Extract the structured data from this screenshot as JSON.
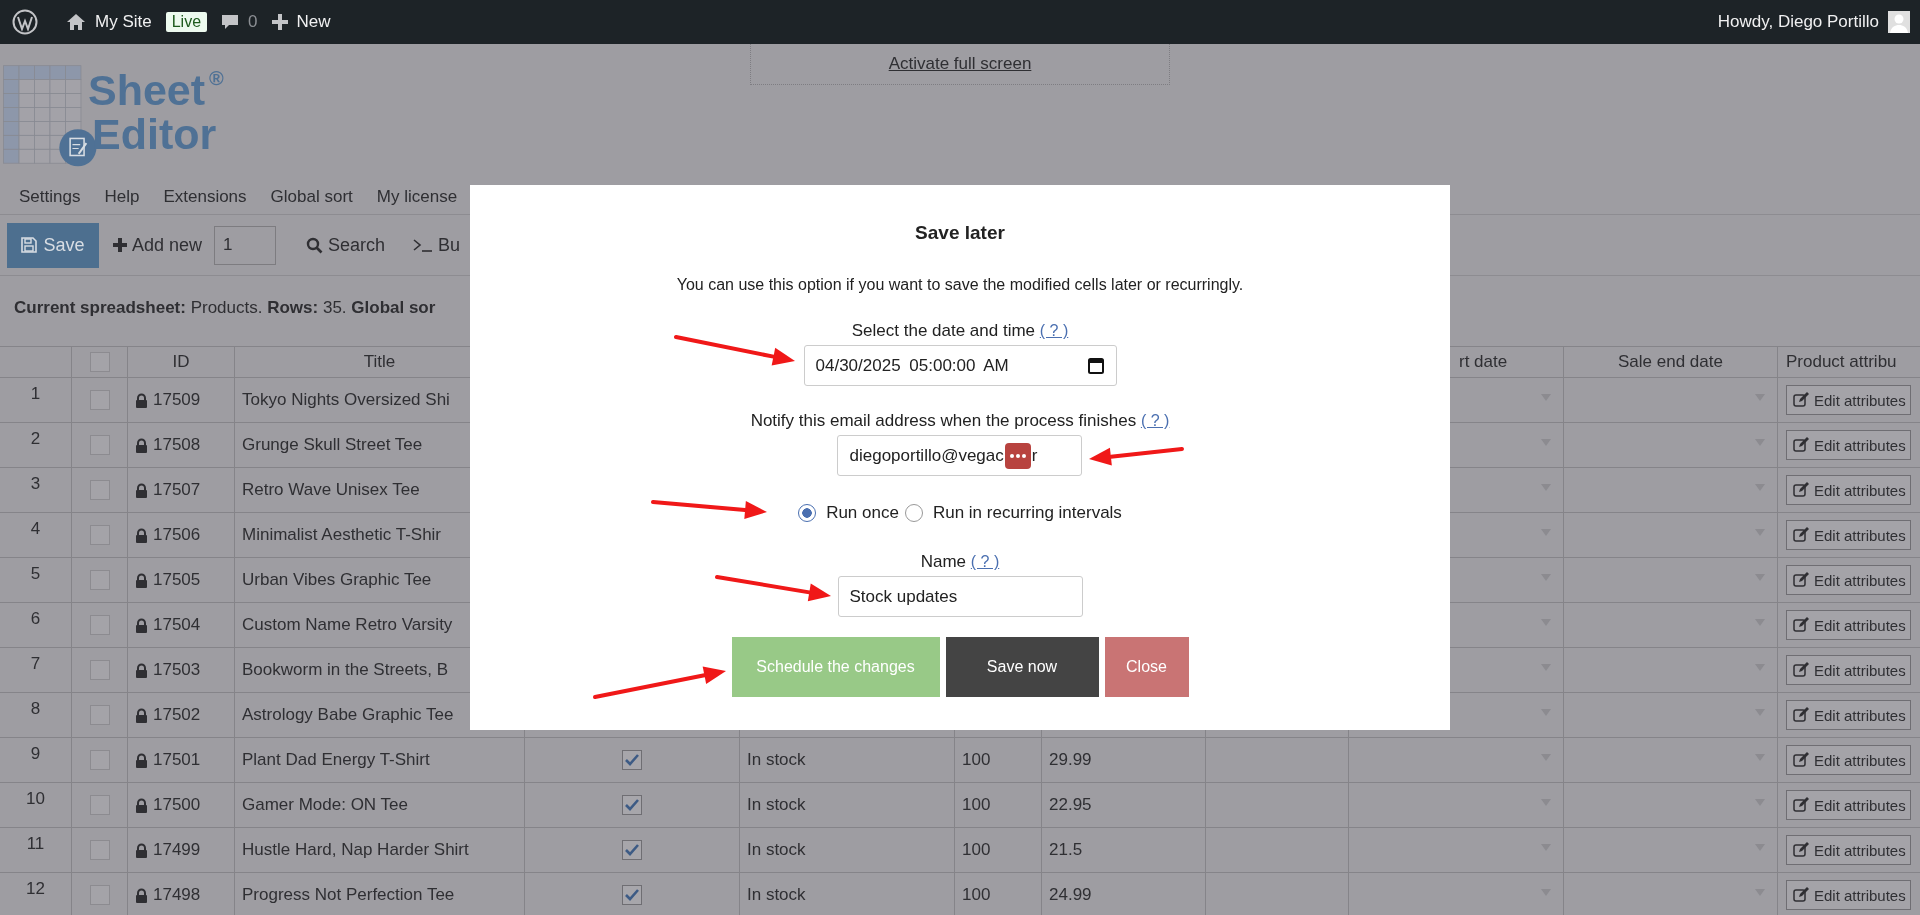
{
  "admin_bar": {
    "site": "My Site",
    "badge": "Live",
    "comments": "0",
    "new": "New",
    "greeting": "Howdy, Diego Portillo"
  },
  "fullscreen_link": "Activate full screen",
  "logo": {
    "line1": "Sheet",
    "mark": "®",
    "line2": "Editor"
  },
  "menu": [
    "Settings",
    "Help",
    "Extensions",
    "Global sort",
    "My license"
  ],
  "toolbar": {
    "save": "Save",
    "add_new": "Add new",
    "count": "1",
    "search": "Search",
    "more": "Bu"
  },
  "info": "**Current spreadsheet:** Products. **Rows:** 35. **Global sor**",
  "table": {
    "select_all_checked": false,
    "columns": [
      "ID",
      "Title",
      "rt date",
      "Sale end date",
      "Product attribu"
    ],
    "rows": [
      {
        "number": "1",
        "checked": false,
        "id": "17509",
        "title": "Tokyo Nights Oversized Shi",
        "action": "Edit attributes"
      },
      {
        "number": "2",
        "checked": false,
        "id": "17508",
        "title": "Grunge Skull Street Tee",
        "action": "Edit attributes"
      },
      {
        "number": "3",
        "checked": false,
        "id": "17507",
        "title": "Retro Wave Unisex Tee",
        "action": "Edit attributes"
      },
      {
        "number": "4",
        "checked": false,
        "id": "17506",
        "title": "Minimalist Aesthetic T-Shir",
        "action": "Edit attributes"
      },
      {
        "number": "5",
        "checked": false,
        "id": "17505",
        "title": "Urban Vibes Graphic Tee",
        "action": "Edit attributes"
      },
      {
        "number": "6",
        "checked": false,
        "id": "17504",
        "title": "Custom Name Retro Varsity",
        "action": "Edit attributes"
      },
      {
        "number": "7",
        "checked": false,
        "id": "17503",
        "title": "Bookworm in the Streets, B",
        "action": "Edit attributes"
      },
      {
        "number": "8",
        "checked": false,
        "id": "17502",
        "title": "Astrology Babe Graphic Tee",
        "action": "Edit attributes"
      },
      {
        "number": "9",
        "checked": false,
        "id": "17501",
        "title": "Plant Dad Energy T-Shirt",
        "column_5_checked": true,
        "stock_status": "In stock",
        "stock": "100",
        "price": "29.99",
        "action": "Edit attributes"
      },
      {
        "number": "10",
        "checked": false,
        "id": "17500",
        "title": "Gamer Mode: ON Tee",
        "column_5_checked": true,
        "stock_status": "In stock",
        "stock": "100",
        "price": "22.95",
        "action": "Edit attributes"
      },
      {
        "number": "11",
        "checked": false,
        "id": "17499",
        "title": "Hustle Hard, Nap Harder Shirt",
        "column_5_checked": true,
        "stock_status": "In stock",
        "stock": "100",
        "price": "21.5",
        "action": "Edit attributes"
      },
      {
        "number": "12",
        "checked": false,
        "id": "17498",
        "title": "Progress Not Perfection Tee",
        "column_5_checked": true,
        "stock_status": "In stock",
        "stock": "100",
        "price": "24.99",
        "action": "Edit attributes"
      }
    ]
  },
  "dialog": {
    "title": "Save later",
    "description": "You can use this option if you want to save the modified cells later or recurringly.",
    "fields": [
      {
        "kind": "datetime",
        "label": "Select the date and time",
        "help": "( ? )",
        "value": "04/30/2025 05:00:00 AM"
      },
      {
        "kind": "email",
        "label": "Notify this email address when the process finishes",
        "help": "( ? )",
        "value": "diegoportillo@vegac",
        "value_end": "r"
      },
      {
        "kind": "radios",
        "options": [
          {
            "label": "Run once",
            "selected": true
          },
          {
            "label": "Run in recurring intervals",
            "selected": false
          }
        ]
      },
      {
        "kind": "text",
        "label": "Name",
        "help": "( ? )",
        "value": "Stock updates"
      }
    ],
    "buttons": [
      {
        "label": "Schedule the changes",
        "kind": "primary"
      },
      {
        "label": "Save now",
        "kind": "dark"
      },
      {
        "label": "Close",
        "kind": "danger"
      }
    ]
  }
}
